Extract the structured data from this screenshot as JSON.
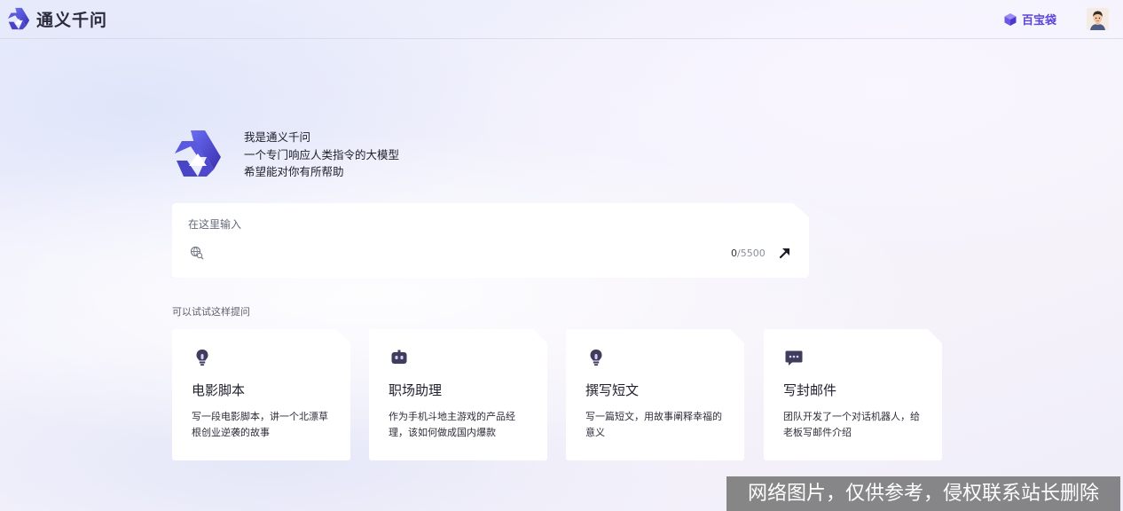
{
  "header": {
    "brand_name": "通义千问",
    "toolbox_label": "百宝袋"
  },
  "intro": {
    "line1": "我是通义千问",
    "line2": "一个专门响应人类指令的大模型",
    "line3": "希望能对你有所帮助"
  },
  "input": {
    "placeholder": "在这里输入",
    "value": "",
    "count_current": "0",
    "count_max": "/5500"
  },
  "suggestions": {
    "title": "可以试试这样提问",
    "cards": [
      {
        "icon": "lightbulb-icon",
        "title": "电影脚本",
        "desc": "写一段电影脚本，讲一个北漂草根创业逆袭的故事"
      },
      {
        "icon": "robot-icon",
        "title": "职场助理",
        "desc": "作为手机斗地主游戏的产品经理，该如何做成国内爆款"
      },
      {
        "icon": "lightbulb-icon",
        "title": "撰写短文",
        "desc": "写一篇短文，用故事阐释幸福的意义"
      },
      {
        "icon": "chat-bubble-icon",
        "title": "写封邮件",
        "desc": "团队开发了一个对话机器人，给老板写邮件介绍"
      }
    ]
  },
  "watermark": "网络图片，仅供参考，侵权联系站长删除",
  "colors": {
    "brand_purple": "#5b46d9",
    "logo_blue": "#4b45c9",
    "icon_dark": "#3f3d5c"
  }
}
